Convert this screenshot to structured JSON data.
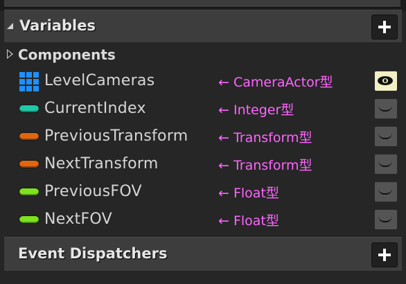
{
  "variables_section": {
    "title": "Variables",
    "add_icon": "plus-icon",
    "collapse_icon": "triangle-collapse-icon"
  },
  "components": {
    "label": "Components",
    "expand_icon": "triangle-expand-icon"
  },
  "variables": [
    {
      "name": "LevelCameras",
      "type_icon": "array-grid-icon",
      "type_color": "#1e90ff",
      "annotation": "← CameraActor型",
      "visibility": "visible",
      "visibility_icon": "open-eye-icon"
    },
    {
      "name": "CurrentIndex",
      "type_icon": "pill-icon",
      "type_color": "#1fc8a6",
      "annotation": "← Integer型",
      "visibility": "hidden",
      "visibility_icon": "closed-eye-icon"
    },
    {
      "name": "PreviousTransform",
      "type_icon": "pill-icon",
      "type_color": "#e0660f",
      "annotation": "← Transform型",
      "visibility": "hidden",
      "visibility_icon": "closed-eye-icon"
    },
    {
      "name": "NextTransform",
      "type_icon": "pill-icon",
      "type_color": "#e0660f",
      "annotation": "← Transform型",
      "visibility": "hidden",
      "visibility_icon": "closed-eye-icon"
    },
    {
      "name": "PreviousFOV",
      "type_icon": "pill-icon",
      "type_color": "#7fe21f",
      "annotation": "← Float型",
      "visibility": "hidden",
      "visibility_icon": "closed-eye-icon"
    },
    {
      "name": "NextFOV",
      "type_icon": "pill-icon",
      "type_color": "#7fe21f",
      "annotation": "← Float型",
      "visibility": "hidden",
      "visibility_icon": "closed-eye-icon"
    }
  ],
  "event_dispatchers_section": {
    "title": "Event Dispatchers",
    "add_icon": "plus-icon"
  },
  "annotation_color": "#ff66ff"
}
